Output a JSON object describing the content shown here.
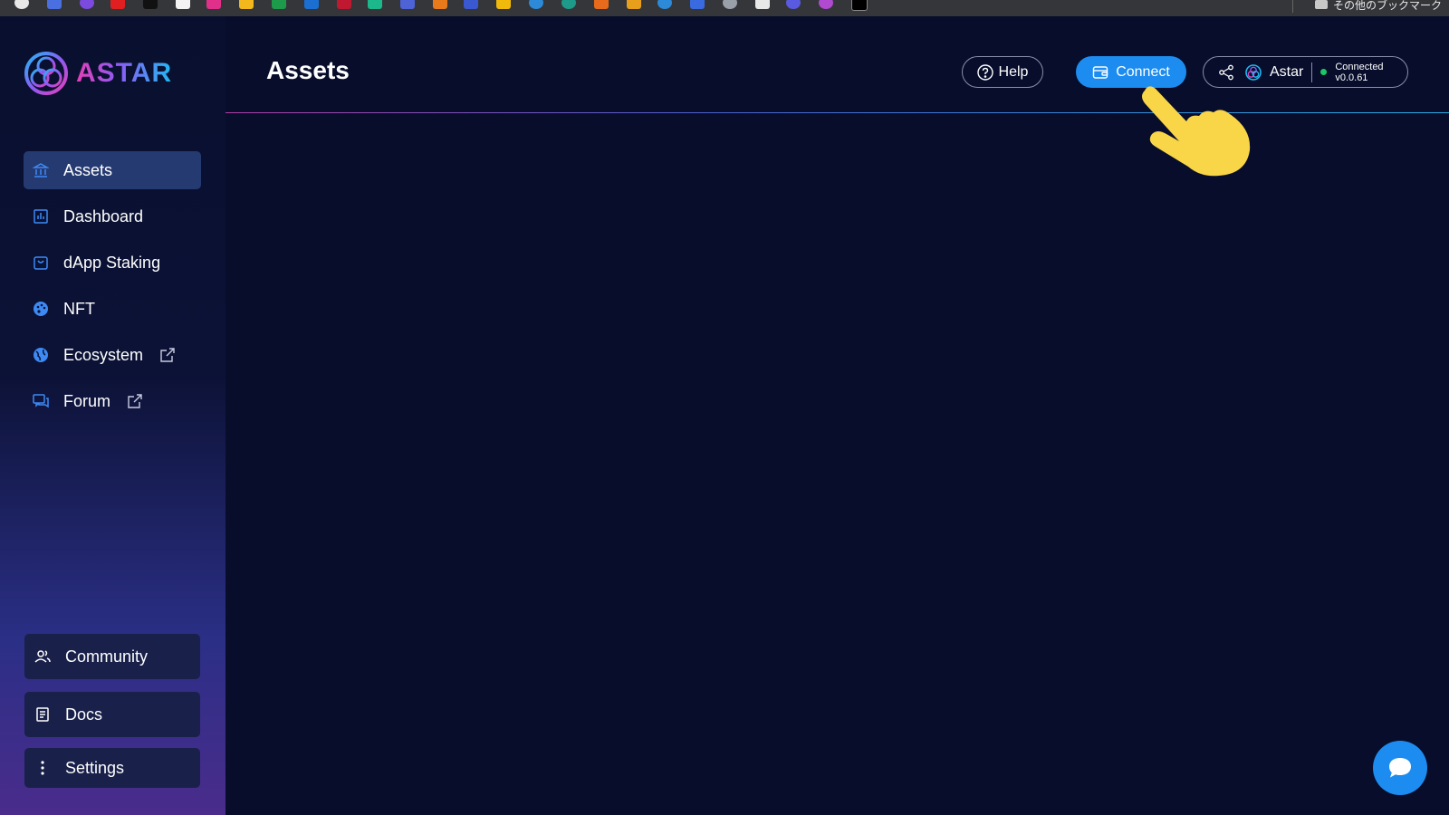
{
  "bookmarks": {
    "other_bookmarks_label": "その他のブックマーク"
  },
  "sidebar": {
    "logo_text": "ASTAR",
    "nav_items": [
      {
        "label": "Assets",
        "icon": "bank-icon",
        "active": true
      },
      {
        "label": "Dashboard",
        "icon": "chart-icon"
      },
      {
        "label": "dApp Staking",
        "icon": "bag-icon"
      },
      {
        "label": "NFT",
        "icon": "palette-icon"
      },
      {
        "label": "Ecosystem",
        "icon": "globe-icon",
        "external": true
      },
      {
        "label": "Forum",
        "icon": "chat-bubbles-icon",
        "external": true
      }
    ],
    "bottom_items": [
      {
        "label": "Community",
        "icon": "people-icon"
      },
      {
        "label": "Docs",
        "icon": "document-icon"
      },
      {
        "label": "Settings",
        "icon": "vertical-dots-icon"
      }
    ]
  },
  "header": {
    "title": "Assets",
    "help_label": "Help",
    "connect_label": "Connect",
    "network_name": "Astar",
    "status_label": "Connected",
    "version": "v0.0.61"
  },
  "colors": {
    "background": "#070d2b",
    "accent_blue": "#1d8cf0",
    "active_nav": "#263a72",
    "status_green": "#1ac865"
  }
}
